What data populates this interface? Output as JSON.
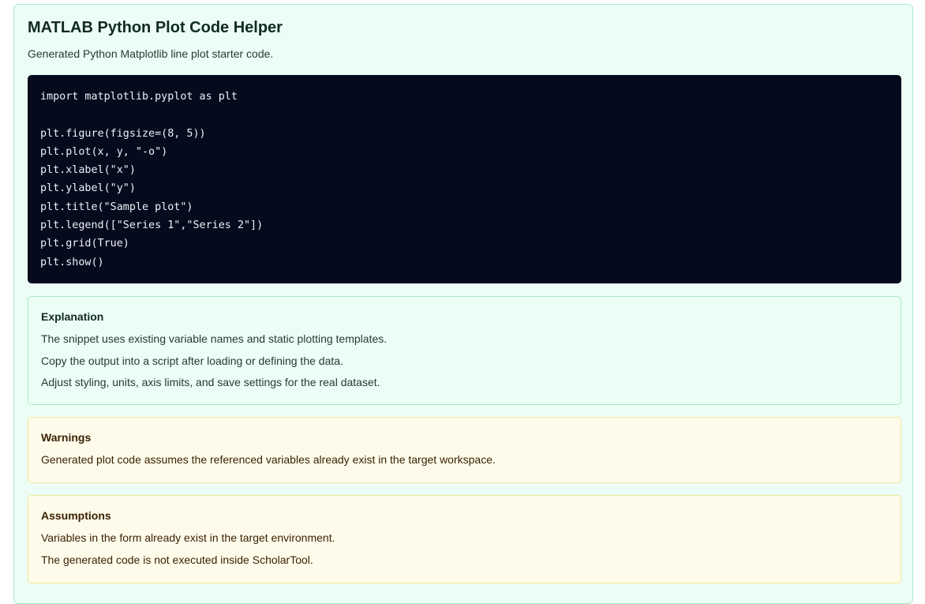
{
  "header": {
    "title": "MATLAB Python Plot Code Helper",
    "subtitle": "Generated Python Matplotlib line plot starter code."
  },
  "code": {
    "lines": [
      "import matplotlib.pyplot as plt",
      "",
      "plt.figure(figsize=(8, 5))",
      "plt.plot(x, y, \"-o\")",
      "plt.xlabel(\"x\")",
      "plt.ylabel(\"y\")",
      "plt.title(\"Sample plot\")",
      "plt.legend([\"Series 1\",\"Series 2\"])",
      "plt.grid(True)",
      "plt.show()"
    ]
  },
  "explanation": {
    "heading": "Explanation",
    "items": [
      "The snippet uses existing variable names and static plotting templates.",
      "Copy the output into a script after loading or defining the data.",
      "Adjust styling, units, axis limits, and save settings for the real dataset."
    ]
  },
  "warnings": {
    "heading": "Warnings",
    "items": [
      "Generated plot code assumes the referenced variables already exist in the target workspace."
    ]
  },
  "assumptions": {
    "heading": "Assumptions",
    "items": [
      "Variables in the form already exist in the target environment.",
      "The generated code is not executed inside ScholarTool."
    ]
  },
  "colors": {
    "panel_background": "#ecfdf5",
    "panel_border": "#a7e9cb",
    "code_background": "#050a1c",
    "code_text": "#eef1f8",
    "warning_background": "#fefbea",
    "warning_border": "#f4e79b"
  }
}
